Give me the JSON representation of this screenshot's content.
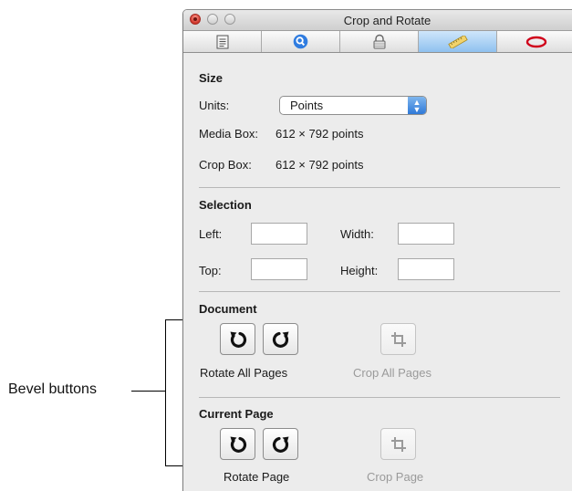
{
  "annotation": {
    "label": "Bevel buttons"
  },
  "window": {
    "title": "Crop and Rotate",
    "toolbar": [
      {
        "icon": "document-icon"
      },
      {
        "icon": "magnifier-icon"
      },
      {
        "icon": "lock-icon"
      },
      {
        "icon": "ruler-icon",
        "active": true
      },
      {
        "icon": "oval-annotation-icon"
      }
    ]
  },
  "size": {
    "title": "Size",
    "units_label": "Units:",
    "units_value": "Points",
    "media_box_label": "Media Box:",
    "media_box_value": "612 × 792 points",
    "crop_box_label": "Crop Box:",
    "crop_box_value": "612 × 792 points"
  },
  "selection": {
    "title": "Selection",
    "left_label": "Left:",
    "width_label": "Width:",
    "top_label": "Top:",
    "height_label": "Height:",
    "left_value": "",
    "width_value": "",
    "top_value": "",
    "height_value": ""
  },
  "document": {
    "title": "Document",
    "rotate_caption": "Rotate All Pages",
    "crop_caption": "Crop All Pages"
  },
  "current_page": {
    "title": "Current Page",
    "rotate_caption": "Rotate Page",
    "crop_caption": "Crop Page"
  },
  "colors": {
    "active_tab": "#8fc1ef",
    "close_button": "#d0352a",
    "disabled_text": "#9a9a9a",
    "oval_icon": "#d0021b",
    "magnifier_icon": "#2f7ce0"
  }
}
